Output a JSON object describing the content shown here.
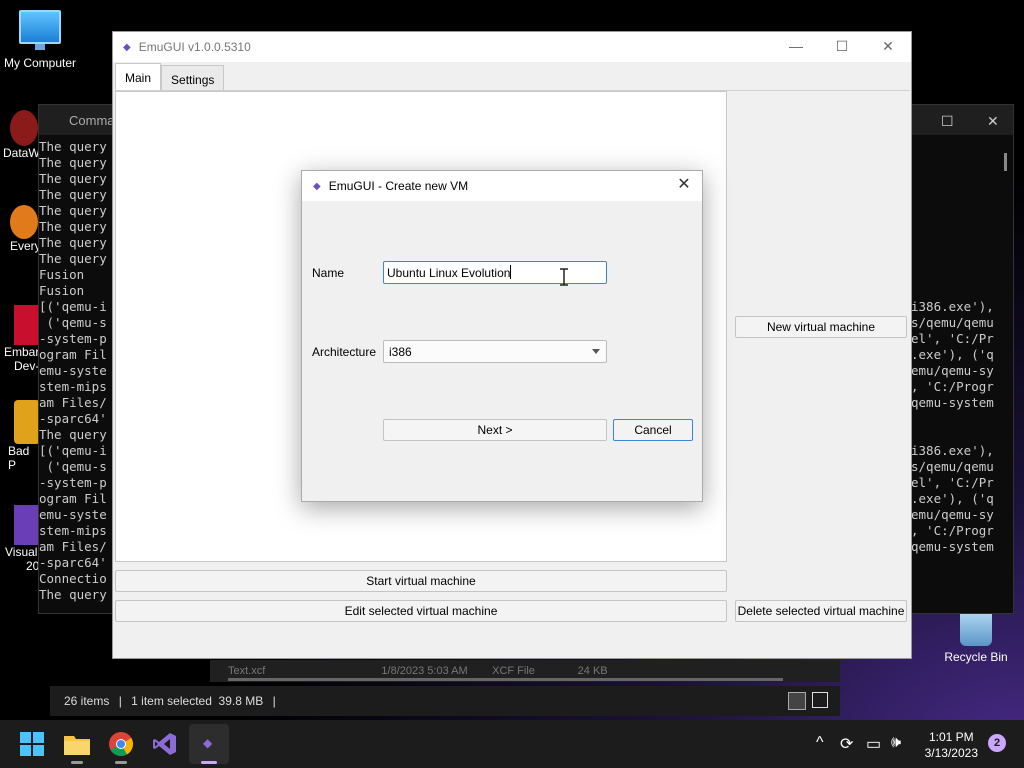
{
  "desktop": {
    "my_computer": "My Computer",
    "recycle_bin": "Recycle Bin",
    "left_labels": [
      "DataW",
      "Every",
      "Embar",
      "Dev-",
      "Bad P",
      "Visual",
      "20"
    ]
  },
  "cmd": {
    "title": "Comma",
    "left_lines": [
      "The query",
      "The query",
      "The query",
      "The query",
      "The query",
      "The query",
      "The query",
      "The query",
      "Fusion",
      "Fusion",
      "[('qemu-i",
      " ('qemu-s",
      "-system-p",
      "ogram Fil",
      "emu-syste",
      "stem-mips",
      "am Files/",
      "-sparc64'",
      "The query",
      "[('qemu-i",
      " ('qemu-s",
      "-system-p",
      "ogram Fil",
      "emu-syste",
      "stem-mips",
      "am Files/",
      "-sparc64'",
      "Connectio",
      "The query"
    ],
    "right_lines": [
      "i386.exe'),",
      "s/qemu/qemu",
      "el', 'C:/Pr",
      ".exe'), ('q",
      "emu/qemu-sy",
      ", 'C:/Progr",
      "qemu-system",
      "",
      "",
      "i386.exe'),",
      "s/qemu/qemu",
      "el', 'C:/Pr",
      ".exe'), ('q",
      "emu/qemu-sy",
      ", 'C:/Progr",
      "qemu-system"
    ]
  },
  "explorer": {
    "row_text": "Text.xcf                                      1/8/2023 5:03 AM        XCF File              24 KB",
    "items_count": "26 items",
    "selected": "1 item selected  39.8 MB"
  },
  "main_window": {
    "title": "EmuGUI v1.0.0.5310",
    "tabs": [
      "Main",
      "Settings"
    ],
    "buttons": {
      "new_vm": "New virtual machine",
      "start_vm": "Start virtual machine",
      "edit_vm": "Edit selected virtual machine",
      "delete_vm": "Delete selected virtual machine"
    }
  },
  "dialog": {
    "title": "EmuGUI - Create new VM",
    "name_label": "Name",
    "name_value": "Ubuntu Linux Evolution",
    "arch_label": "Architecture",
    "arch_value": "i386",
    "next_label": "Next >",
    "cancel_label": "Cancel"
  },
  "taskbar": {
    "time": "1:01 PM",
    "date": "3/13/2023",
    "notification_count": "2",
    "apps": [
      "start-icon",
      "file-explorer-icon",
      "chrome-icon",
      "visual-studio-icon",
      "emugui-icon"
    ]
  },
  "colors": {
    "accent": "#3a86d8",
    "emugui_icon": "#6b4fbf",
    "taskbar": "#1c1c1c"
  }
}
